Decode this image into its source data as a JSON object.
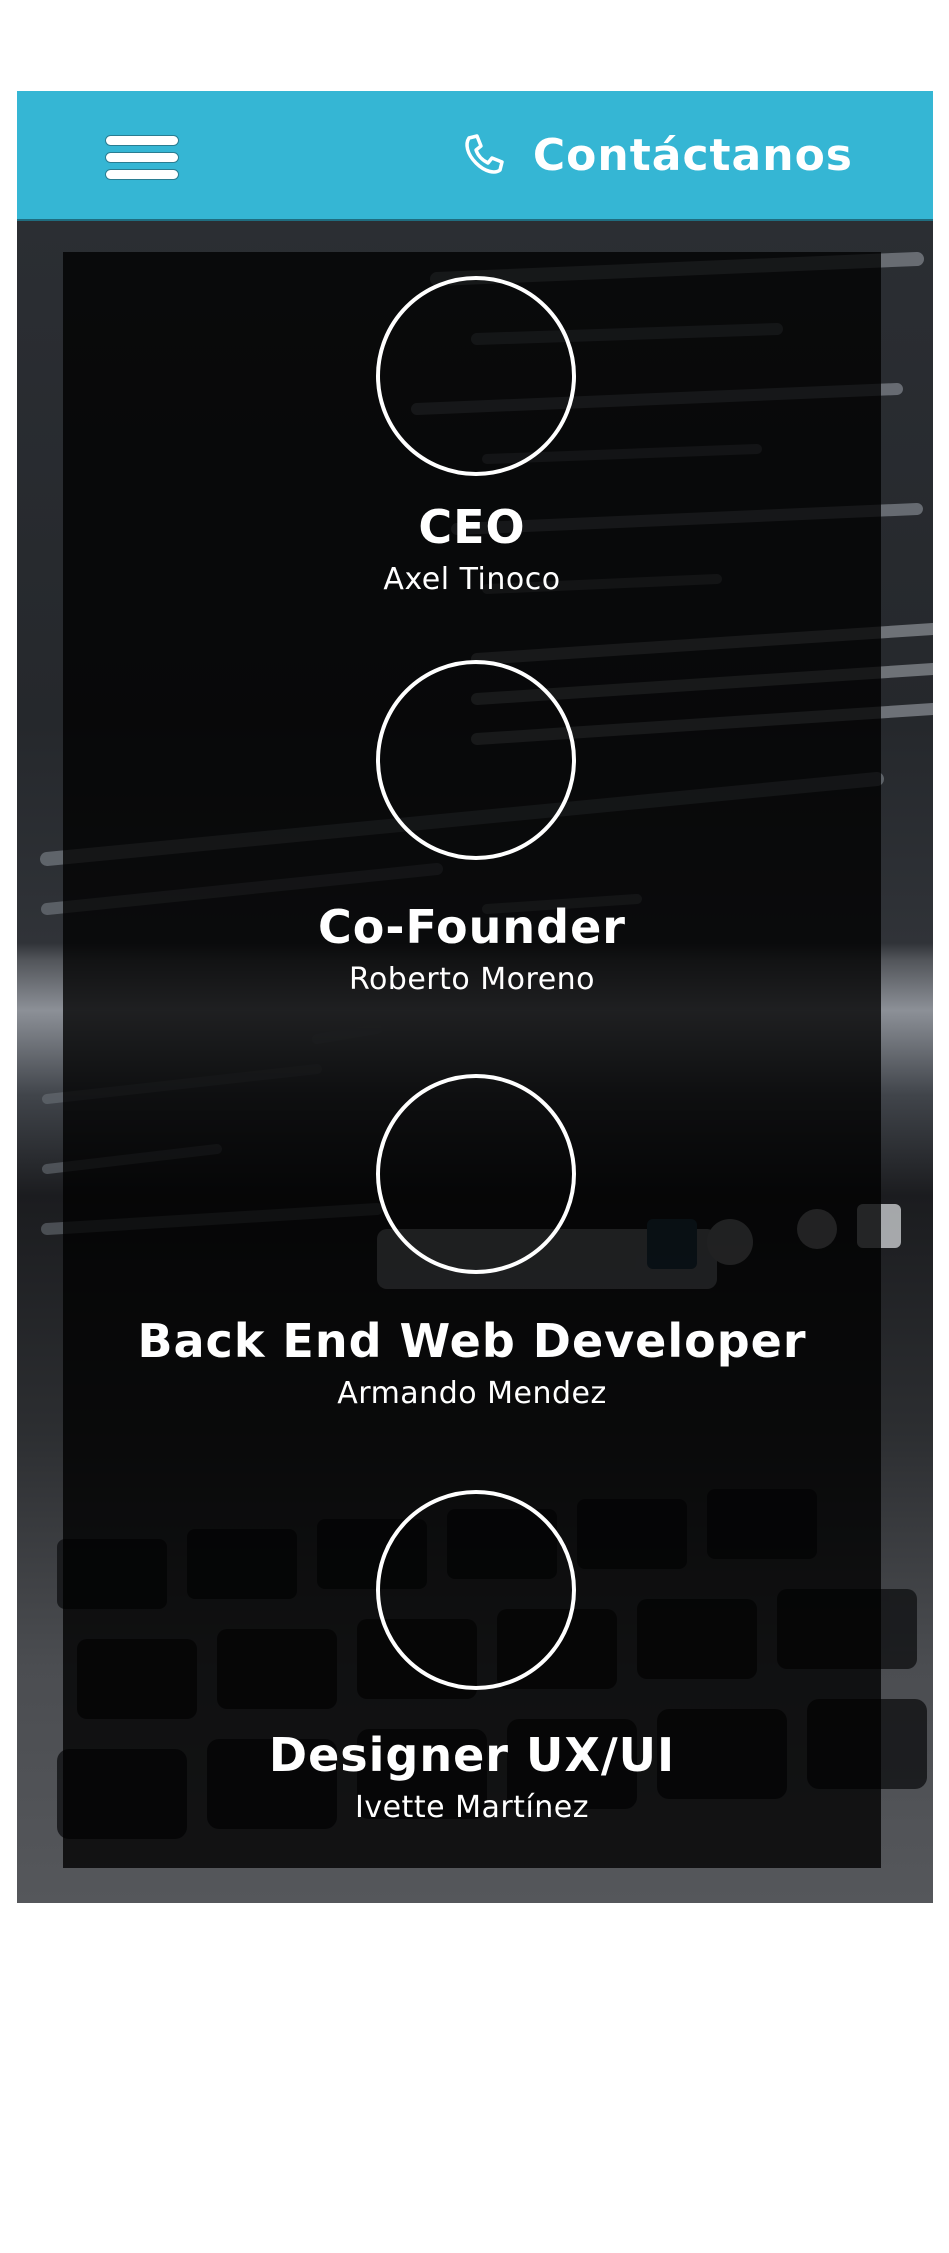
{
  "header": {
    "contact_label": "Contáctanos",
    "contact_icon": "phone-handset-icon",
    "menu_icon": "hamburger-menu-icon",
    "background_color": "#35b6d4"
  },
  "team": {
    "members": [
      {
        "role": "CEO",
        "name": "Axel Tinoco"
      },
      {
        "role": "Co-Founder",
        "name": "Roberto Moreno"
      },
      {
        "role": "Back End Web Developer",
        "name": "Armando Mendez"
      },
      {
        "role": "Designer UX/UI",
        "name": "Ivette Martínez"
      }
    ]
  }
}
